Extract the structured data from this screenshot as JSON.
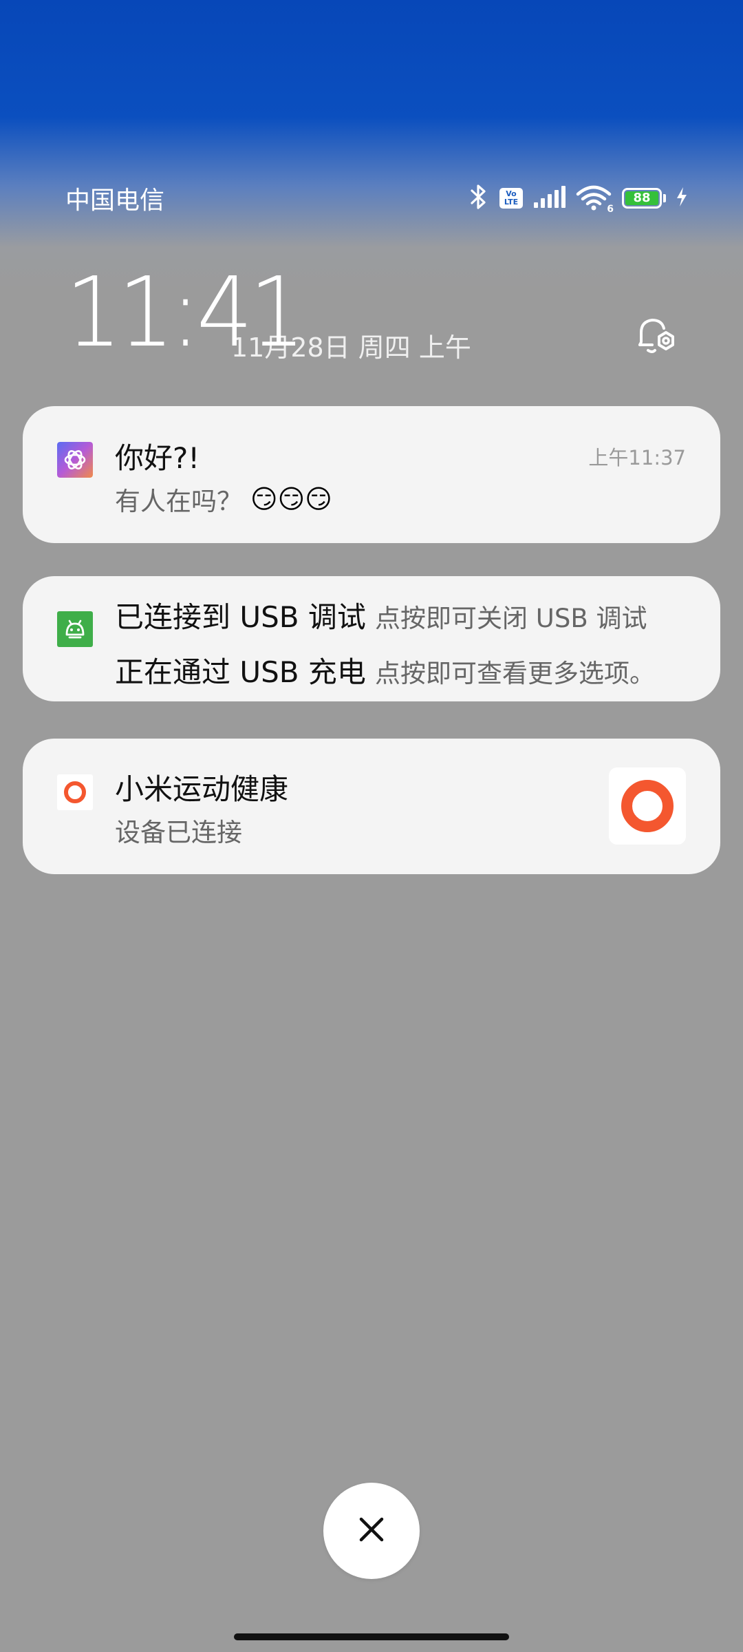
{
  "status_bar": {
    "carrier": "中国电信",
    "icons": [
      "bluetooth-icon",
      "volte-icon",
      "signal-icon",
      "wifi-6-icon",
      "battery-icon",
      "charging-icon"
    ],
    "volte_label": "Vo\nLTE",
    "wifi_generation": "6",
    "battery_level": "88"
  },
  "lockscreen": {
    "time": "11:41",
    "date": "11月28日 周四 上午"
  },
  "notifications": [
    {
      "app_icon": "chatgpt-icon",
      "title": "你好?!",
      "body": "有人在吗？",
      "emoji": "😏😏😏",
      "time": "上午11:37"
    },
    {
      "app_icon": "android-icon",
      "line1_title": "已连接到 USB 调试",
      "line1_text": "点按即可关闭 USB 调试",
      "line2_title": "正在通过 USB 充电",
      "line2_text": "点按即可查看更多选项。"
    },
    {
      "app_icon": "mi-fitness-icon",
      "title": "小米运动健康",
      "body": "设备已连接",
      "thumbnail_icon": "mi-fitness-ring-icon"
    }
  ],
  "actions": {
    "clear_all_icon": "close-icon"
  },
  "colors": {
    "top_gradient": "#0747b8",
    "background": "#9b9b9b",
    "card": "#f4f4f4",
    "battery_fill": "#35c03a",
    "mi_fitness": "#f4572f",
    "android_green": "#3fae49"
  }
}
